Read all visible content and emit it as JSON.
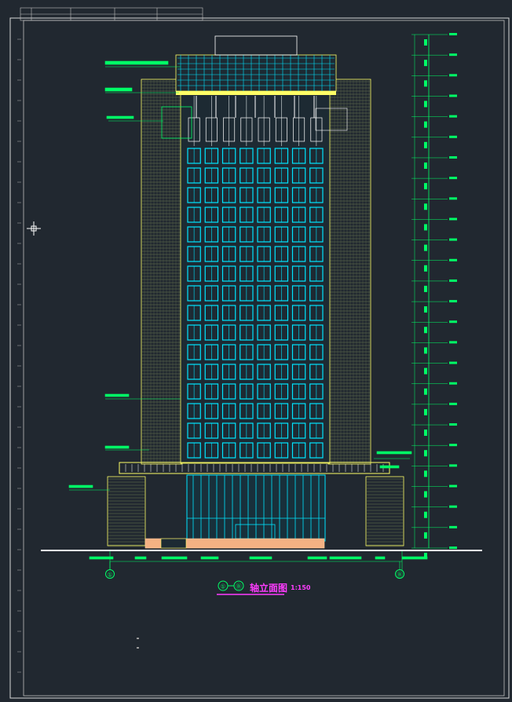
{
  "drawing": {
    "title": "轴立面图",
    "scale": "1:150",
    "axis_start": "①",
    "axis_end": "Ⓑ",
    "floors_above_podium": 16,
    "tower_window_columns": 8,
    "elevation_marks": 26
  },
  "colors": {
    "background": "#212830",
    "frame": "#d8d8d8",
    "outline": "#ffff66",
    "glass": "#00e5ff",
    "annotation": "#00ff66",
    "title": "#ff3cff",
    "entrance": "#f4b183"
  }
}
